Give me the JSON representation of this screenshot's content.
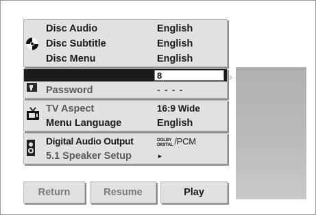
{
  "section1": {
    "disc_audio": {
      "label": "Disc Audio",
      "value": "English"
    },
    "disc_subtitle": {
      "label": "Disc Subtitle",
      "value": "English"
    },
    "disc_menu": {
      "label": "Disc Menu",
      "value": "English"
    }
  },
  "section2": {
    "rating_value": "8",
    "password_label": "Password",
    "password_value": "- - - -"
  },
  "section3": {
    "tv_aspect": {
      "label": "TV Aspect",
      "value": "16:9 Wide"
    },
    "menu_language": {
      "label": "Menu Language",
      "value": "English"
    }
  },
  "section4": {
    "digital_audio": {
      "label": "Digital Audio Output",
      "value_logo_line1": "DOLBY",
      "value_logo_line2": "DIGITAL",
      "value": "/PCM"
    },
    "speaker_setup": {
      "label": "5.1 Speaker Setup",
      "value": "►"
    }
  },
  "buttons": {
    "return": "Return",
    "resume": "Resume",
    "play": "Play"
  },
  "nav_arrow": "›",
  "icons": [
    "disc-icon",
    "lock-icon",
    "tv-icon",
    "speaker-icon",
    "chevron-right-icon"
  ]
}
